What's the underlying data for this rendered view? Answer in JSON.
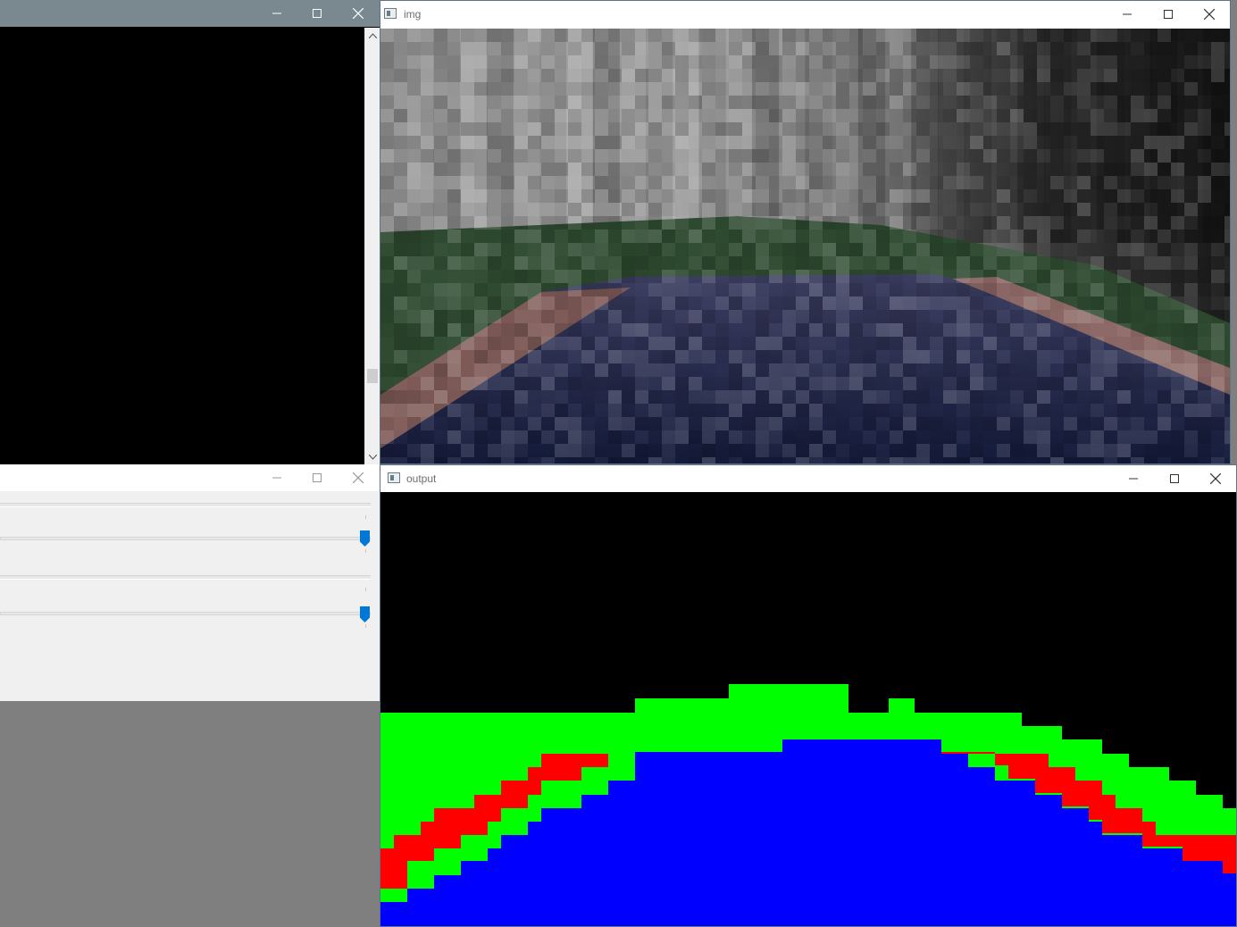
{
  "windows": {
    "top_left": {
      "title": ""
    },
    "img": {
      "title": "img"
    },
    "trackbar": {
      "title": ""
    },
    "output": {
      "title": "output"
    }
  },
  "trackbars": [
    {
      "value_fraction": 1.0
    },
    {
      "value_fraction": 1.0
    }
  ],
  "colors": {
    "segment_road": "#0000ff",
    "segment_curb": "#ff0000",
    "segment_grass": "#00ff00",
    "background": "#000000",
    "trackbar_thumb": "#0078d7"
  },
  "icons": {
    "minimize": "minimize-icon",
    "maximize": "maximize-icon",
    "close": "close-icon"
  }
}
